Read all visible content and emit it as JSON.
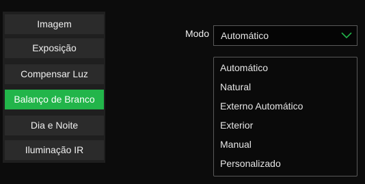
{
  "sidebar": {
    "items": [
      {
        "label": "Imagem"
      },
      {
        "label": "Exposição"
      },
      {
        "label": "Compensar Luz"
      },
      {
        "label": "Balanço de Branco"
      },
      {
        "label": "Dia e Noite"
      },
      {
        "label": "Iluminação IR"
      }
    ],
    "active_index": 3
  },
  "mode": {
    "label": "Modo",
    "selected": "Automático",
    "options": [
      "Automático",
      "Natural",
      "Externo Automático",
      "Exterior",
      "Manual",
      "Personalizado"
    ]
  },
  "colors": {
    "accent": "#22b54a",
    "chevron": "#22b54a"
  },
  "icons": {
    "select_chevron": "chevron-down-icon"
  }
}
